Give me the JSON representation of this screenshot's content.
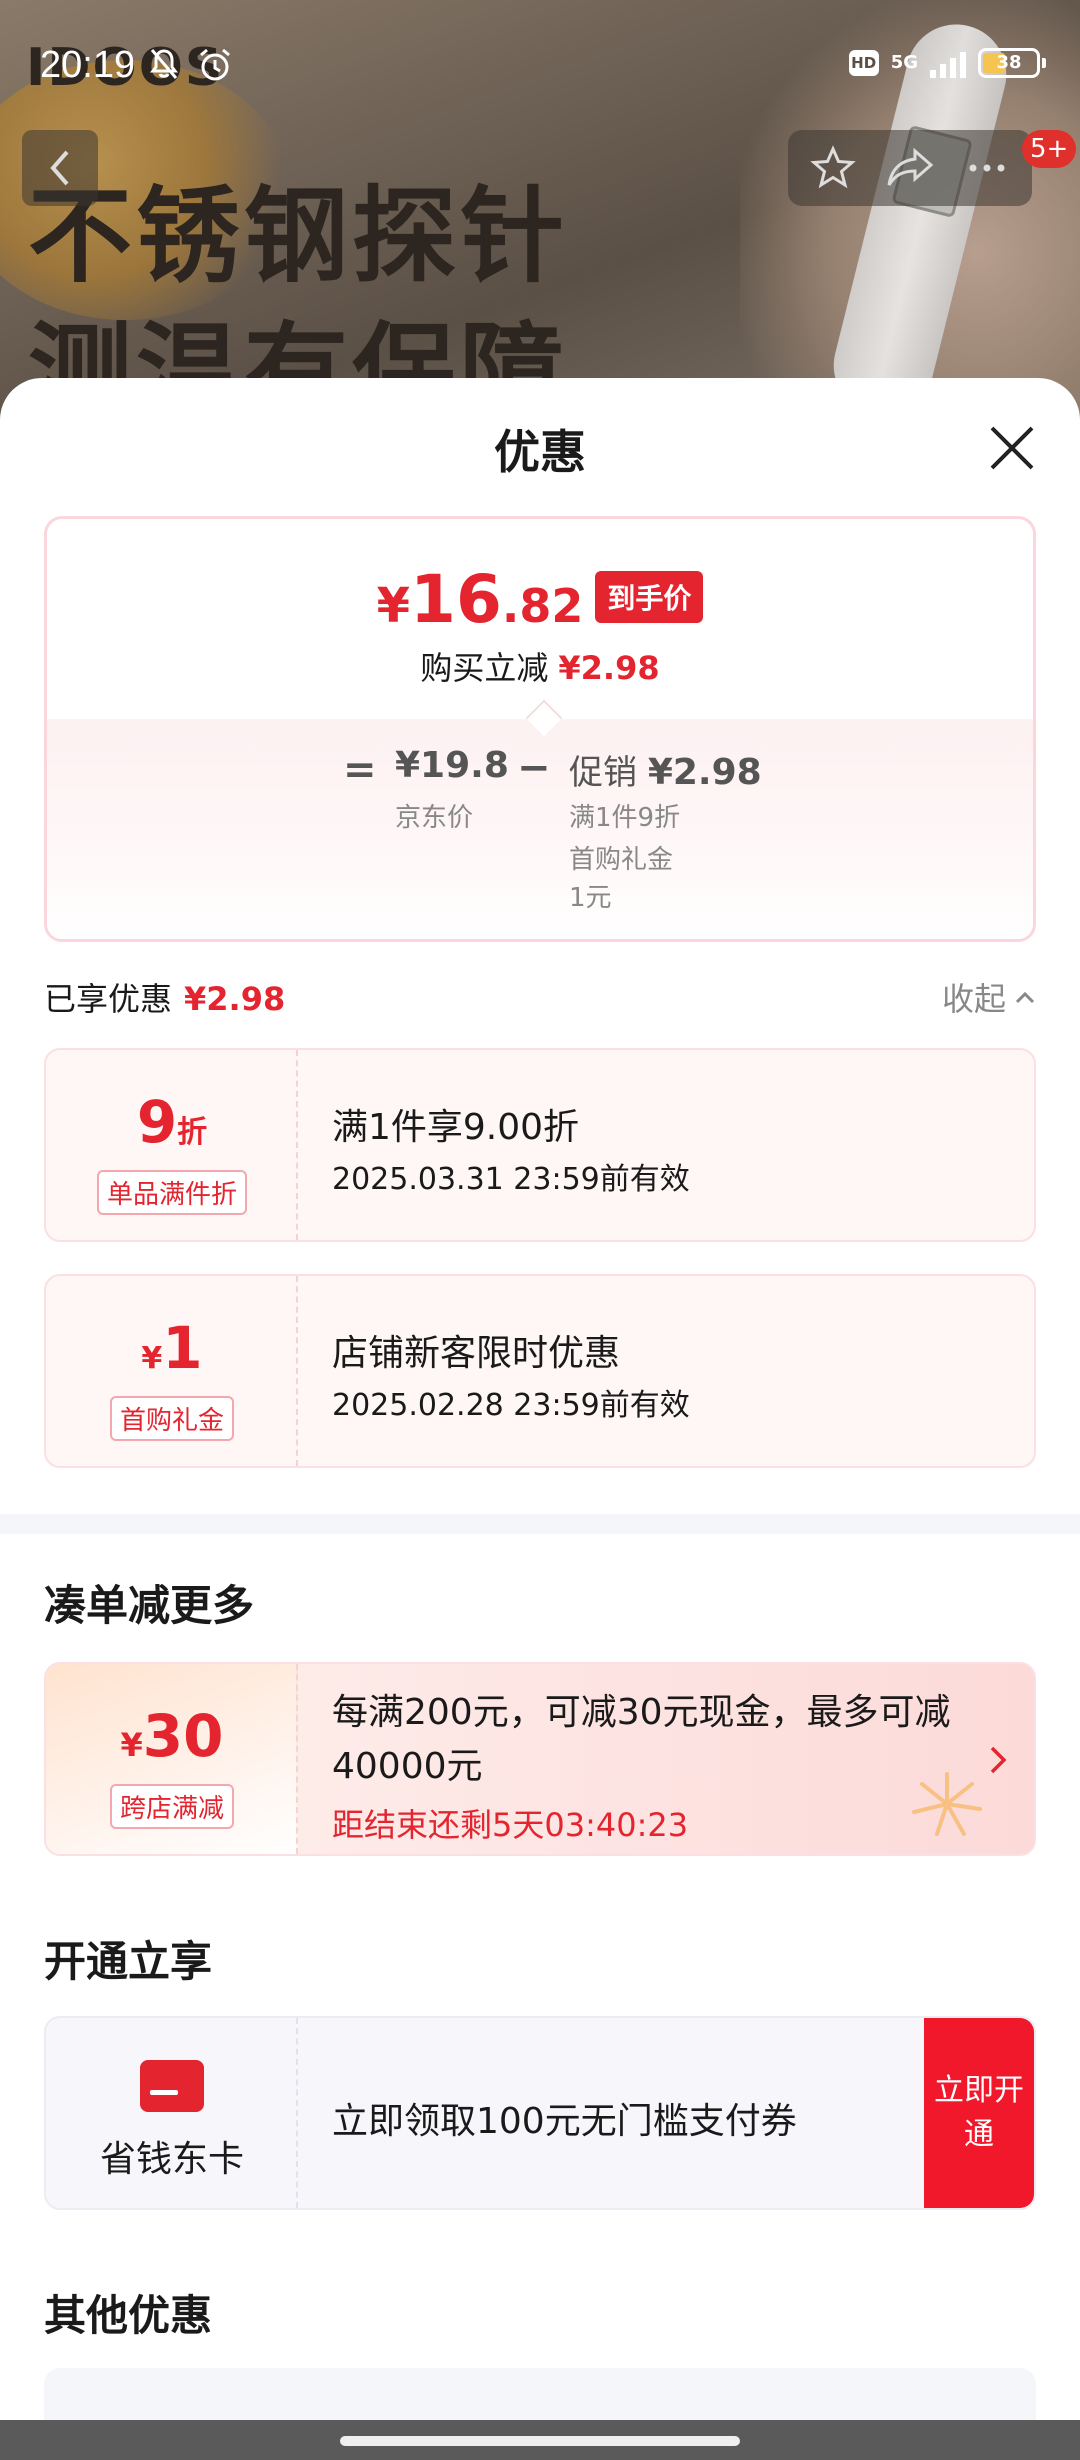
{
  "status_bar": {
    "time": "20:19",
    "hd": "HD",
    "network": "5G",
    "battery": "38"
  },
  "background": {
    "brand": "IDOOS",
    "headline_line1": "不锈钢探针",
    "headline_line2": "测温有保障"
  },
  "nav": {
    "badge": "5+"
  },
  "sheet": {
    "title": "优惠"
  },
  "price_card": {
    "currency": "¥",
    "final_int": "16",
    "final_dec": ".82",
    "final_tag": "到手价",
    "instant_label": "购买立减",
    "instant_value": "¥2.98",
    "eq": "=",
    "jd_price": "¥19.8",
    "jd_label": "京东价",
    "minus": "−",
    "promo_label": "促销",
    "promo_value": "¥2.98",
    "promo_sub": "满1件9折",
    "gift_label": "首购礼金",
    "gift_value": "1元"
  },
  "enjoyed": {
    "label": "已享优惠",
    "value": "¥2.98",
    "collapse": "收起"
  },
  "coupons": [
    {
      "amount": "9",
      "unit": "折",
      "chip": "单品满件折",
      "title": "满1件享9.00折",
      "expire": "2025.03.31 23:59前有效"
    },
    {
      "currency": "¥",
      "amount": "1",
      "chip": "首购礼金",
      "title": "店铺新客限时优惠",
      "expire": "2025.02.28 23:59前有效"
    }
  ],
  "more_section": {
    "title": "凑单减更多",
    "currency": "¥",
    "amount": "30",
    "chip": "跨店满减",
    "text": "每满200元，可减30元现金，最多可减40000元",
    "timer": "距结束还剩5天03:40:23"
  },
  "member_section": {
    "title": "开通立享",
    "name": "省钱东卡",
    "text": "立即领取100元无门槛支付券",
    "button": "立即开通"
  },
  "other_section": {
    "title": "其他优惠"
  },
  "colors": {
    "accent": "#e4252f",
    "button_red": "#f0182a"
  }
}
